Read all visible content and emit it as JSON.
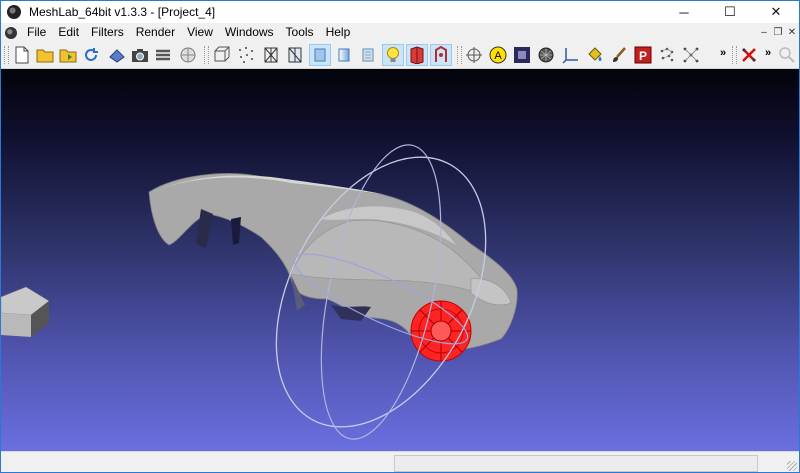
{
  "window": {
    "title": "MeshLab_64bit v1.3.3 - [Project_4]",
    "minimize_glyph": "─",
    "maximize_glyph": "☐",
    "close_glyph": "✕"
  },
  "menu": {
    "items": [
      "File",
      "Edit",
      "Filters",
      "Render",
      "View",
      "Windows",
      "Tools",
      "Help"
    ],
    "mdi_min_glyph": "–",
    "mdi_restore_glyph": "❐",
    "mdi_close_glyph": "✕"
  },
  "toolbar": {
    "overflow_glyph": "»",
    "groups": [
      [
        "new-document-icon",
        "open-folder-icon",
        "import-mesh-icon",
        "reload-icon",
        "save-icon",
        "snapshot-icon",
        "layers-icon",
        "globe-icon"
      ],
      [
        "bounding-box-icon",
        "points-icon",
        "wireframe-icon",
        "hidden-lines-icon",
        "flat-shading-icon",
        "smooth-shading-icon",
        "texture-icon",
        "light-bulb-icon",
        "double-side-lighting-icon",
        "fancy-lighting-icon"
      ],
      [
        "crosshair-icon",
        "annotation-a-icon",
        "measure-icon",
        "select-vertices-icon",
        "axes-icon",
        "paint-bucket-icon",
        "brush-icon",
        "pick-points-icon",
        "align-icon",
        "align-tool-icon"
      ],
      [
        "close-mesh-icon",
        "zoom-icon"
      ]
    ],
    "active_icons": [
      "flat-shading-icon",
      "light-bulb-icon",
      "double-side-lighting-icon",
      "fancy-lighting-icon"
    ]
  },
  "colors": {
    "accent": "#2b79d6",
    "selection": "#cce4f7",
    "highlight_mesh": "#ff2020",
    "mesh": "#a7a7a7"
  }
}
